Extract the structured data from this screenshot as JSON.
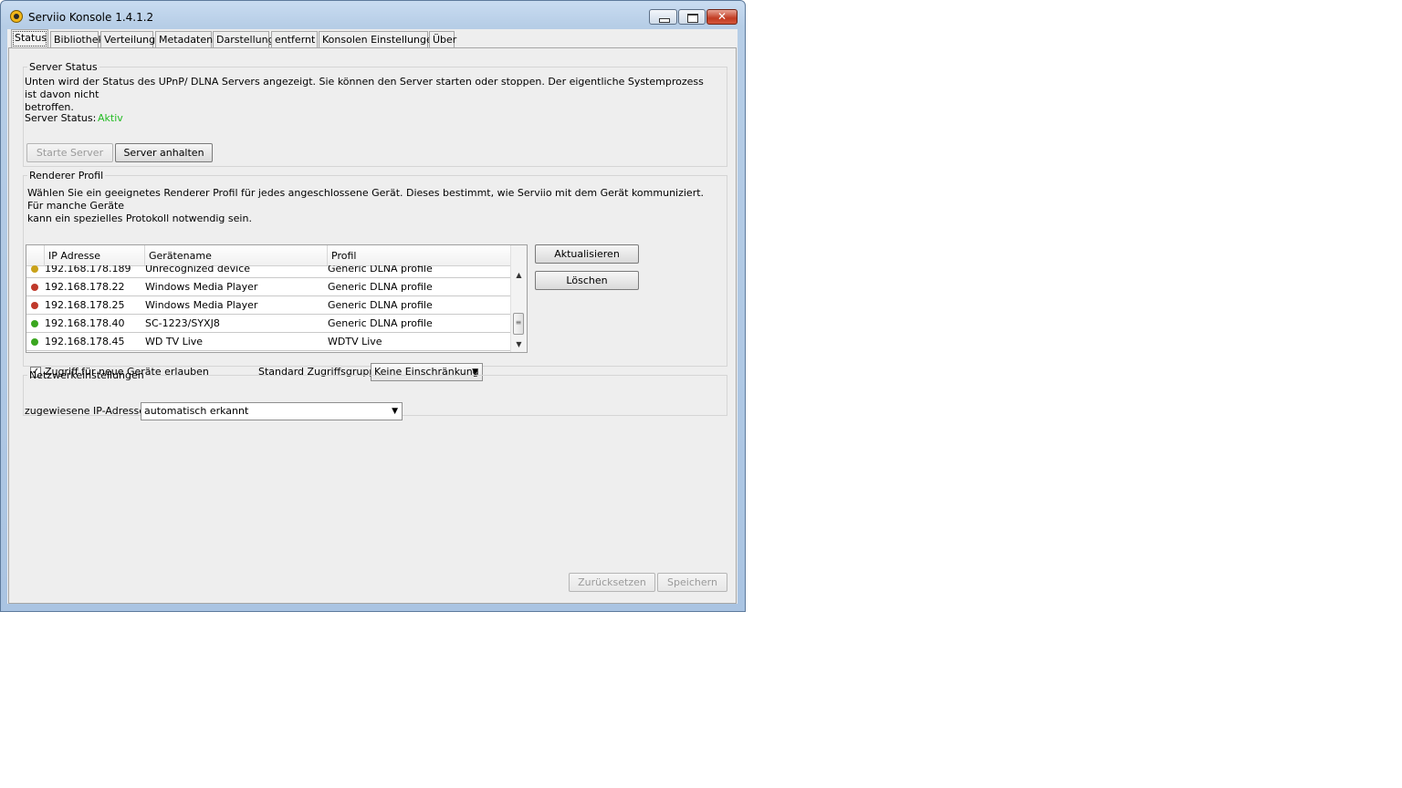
{
  "window": {
    "title": "Serviio Konsole 1.4.1.2",
    "buttons": {
      "minimize": "▁",
      "maximize": "□",
      "close": "✕"
    }
  },
  "tabs": [
    {
      "label": "Status",
      "active": true
    },
    {
      "label": "Bibliothek"
    },
    {
      "label": "Verteilung"
    },
    {
      "label": "Metadaten"
    },
    {
      "label": "Darstellung"
    },
    {
      "label": "entfernt"
    },
    {
      "label": "Konsolen Einstellungen"
    },
    {
      "label": "Über"
    }
  ],
  "server_status": {
    "legend": "Server Status",
    "description_line1": "Unten wird der Status des UPnP/ DLNA Servers angezeigt. Sie können den Server starten oder stoppen. Der eigentliche Systemprozess ist davon nicht",
    "description_line2": "betroffen.",
    "status_label": "Server Status:",
    "status_value": "Aktiv",
    "status_color": "#22bb22",
    "start_button": "Starte Server",
    "stop_button": "Server anhalten"
  },
  "renderer": {
    "legend": "Renderer Profil",
    "description_line1": "Wählen Sie ein geeignetes Renderer Profil für jedes angeschlossene Gerät. Dieses bestimmt, wie Serviio mit dem Gerät kommuniziert. Für manche Geräte",
    "description_line2": "kann ein spezielles Protokoll notwendig sein.",
    "columns": [
      "",
      "IP Adresse",
      "Gerätename",
      "Profil"
    ],
    "rows": [
      {
        "status": "yellow",
        "status_color": "#c9a21a",
        "ip": "192.168.178.189",
        "name": "Unrecognized device",
        "profile": "Generic DLNA profile"
      },
      {
        "status": "red",
        "status_color": "#c0392b",
        "ip": "192.168.178.22",
        "name": "Windows Media Player",
        "profile": "Generic DLNA profile"
      },
      {
        "status": "red",
        "status_color": "#c0392b",
        "ip": "192.168.178.25",
        "name": "Windows Media Player",
        "profile": "Generic DLNA profile"
      },
      {
        "status": "green",
        "status_color": "#3aa61f",
        "ip": "192.168.178.40",
        "name": "SC-1223/SYXJ8",
        "profile": "Generic DLNA profile"
      },
      {
        "status": "green",
        "status_color": "#3aa61f",
        "ip": "192.168.178.45",
        "name": "WD TV Live",
        "profile": "WDTV Live"
      }
    ],
    "refresh_button": "Aktualisieren",
    "delete_button": "Löschen",
    "allow_new_devices_label": "Zugriff für neue Geräte erlauben",
    "allow_new_devices_checked": true,
    "default_group_label": "Standard Zugriffsgruppe",
    "default_group_value": "Keine Einschränkung"
  },
  "network": {
    "legend": "Netzwerkeinstellungen",
    "ip_label": "zugewiesene IP-Adresse:",
    "ip_value": "automatisch erkannt"
  },
  "footer": {
    "reset_button": "Zurücksetzen",
    "save_button": "Speichern"
  }
}
